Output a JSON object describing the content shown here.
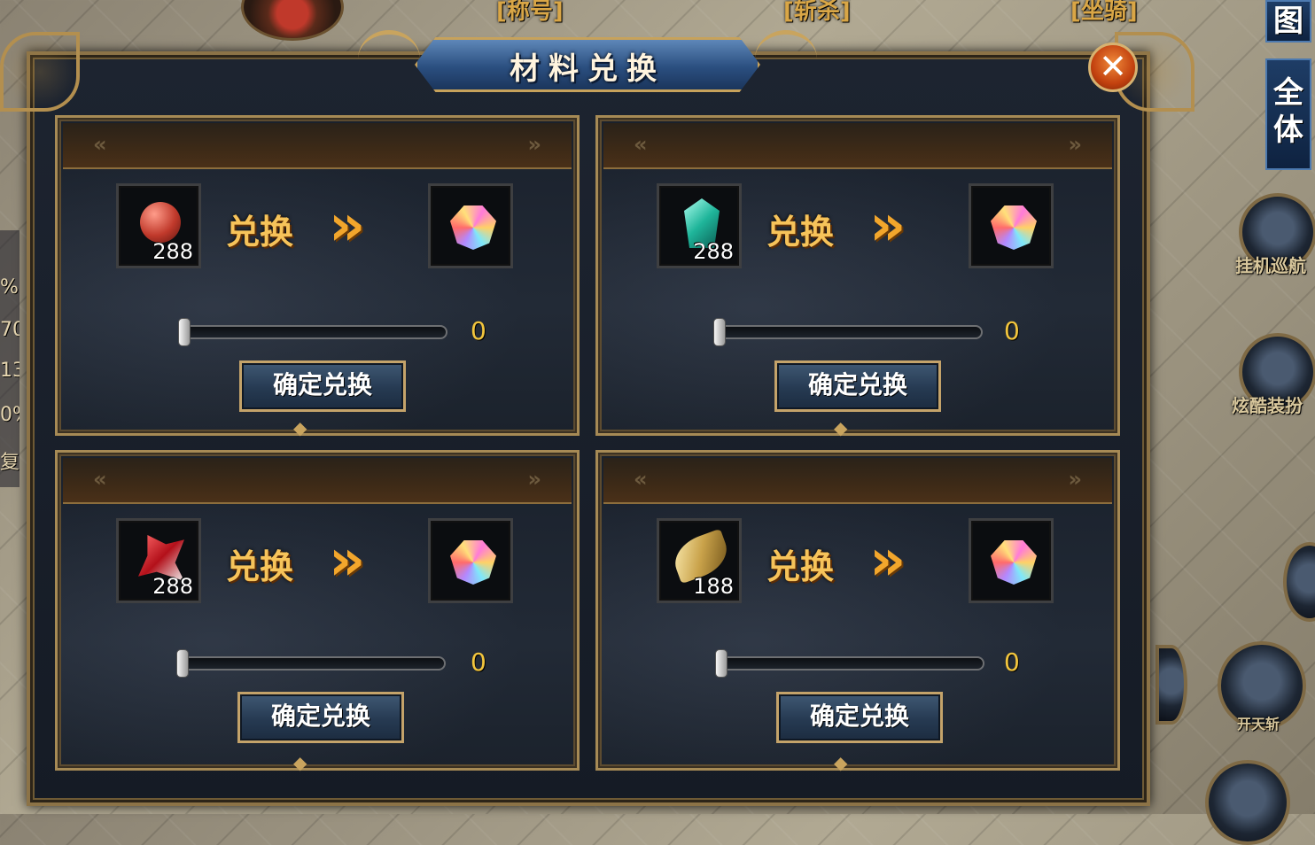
{
  "top_labels": [
    {
      "text": "[称号]"
    },
    {
      "text": "[斩杀]"
    },
    {
      "text": "[坐骑]"
    }
  ],
  "side_buttons": [
    "图",
    "全\n体"
  ],
  "skills": [
    "挂机巡航",
    "炫酷装扮",
    "开天斩"
  ],
  "left_stats": [
    "%",
    "70",
    "13",
    "0%",
    "复"
  ],
  "window": {
    "title": "材料兑换",
    "close_label": "✕"
  },
  "panels": [
    {
      "source_item": "red-orb",
      "source_count": "288",
      "exchange_label": "兑换",
      "chevron": "»",
      "result_item": "rainbow-gem",
      "slider_value": "0",
      "confirm_label": "确定兑换"
    },
    {
      "source_item": "cyan-crystal",
      "source_count": "288",
      "exchange_label": "兑换",
      "chevron": "»",
      "result_item": "rainbow-gem",
      "slider_value": "0",
      "confirm_label": "确定兑换"
    },
    {
      "source_item": "red-fragment",
      "source_count": "288",
      "exchange_label": "兑换",
      "chevron": "»",
      "result_item": "rainbow-gem",
      "slider_value": "0",
      "confirm_label": "确定兑换"
    },
    {
      "source_item": "golden-feather",
      "source_count": "188",
      "exchange_label": "兑换",
      "chevron": "»",
      "result_item": "rainbow-gem",
      "slider_value": "0",
      "confirm_label": "确定兑换"
    }
  ],
  "colors": {
    "gold": "#f6c35a",
    "value_yellow": "#f2c53d",
    "frame_gold": "#a68a55"
  }
}
